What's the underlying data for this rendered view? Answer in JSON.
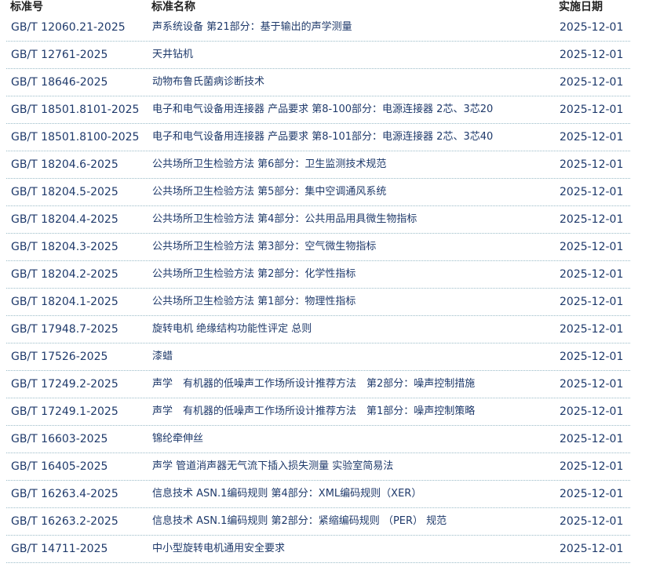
{
  "table": {
    "headers": [
      "标准号",
      "标准名称",
      "实施日期"
    ],
    "rows": [
      [
        "GB/T 12060.21-2025",
        "声系统设备 第21部分：基于输出的声学测量",
        "2025-12-01"
      ],
      [
        "GB/T 12761-2025",
        "天井钻机",
        "2025-12-01"
      ],
      [
        "GB/T 18646-2025",
        "动物布鲁氏菌病诊断技术",
        "2025-12-01"
      ],
      [
        "GB/T 18501.8101-2025",
        "电子和电气设备用连接器 产品要求 第8-100部分：电源连接器 2芯、3芯20",
        "2025-12-01"
      ],
      [
        "GB/T 18501.8100-2025",
        "电子和电气设备用连接器 产品要求 第8-101部分：电源连接器 2芯、3芯40",
        "2025-12-01"
      ],
      [
        "GB/T 18204.6-2025",
        "公共场所卫生检验方法 第6部分：卫生监测技术规范",
        "2025-12-01"
      ],
      [
        "GB/T 18204.5-2025",
        "公共场所卫生检验方法 第5部分：集中空调通风系统",
        "2025-12-01"
      ],
      [
        "GB/T 18204.4-2025",
        "公共场所卫生检验方法 第4部分：公共用品用具微生物指标",
        "2025-12-01"
      ],
      [
        "GB/T 18204.3-2025",
        "公共场所卫生检验方法 第3部分：空气微生物指标",
        "2025-12-01"
      ],
      [
        "GB/T 18204.2-2025",
        "公共场所卫生检验方法 第2部分：化学性指标",
        "2025-12-01"
      ],
      [
        "GB/T 18204.1-2025",
        "公共场所卫生检验方法 第1部分：物理性指标",
        "2025-12-01"
      ],
      [
        "GB/T 17948.7-2025",
        "旋转电机 绝缘结构功能性评定 总则",
        "2025-12-01"
      ],
      [
        "GB/T 17526-2025",
        "漆蜡",
        "2025-12-01"
      ],
      [
        "GB/T 17249.2-2025",
        "声学　有机器的低噪声工作场所设计推荐方法　第2部分：噪声控制措施",
        "2025-12-01"
      ],
      [
        "GB/T 17249.1-2025",
        "声学　有机器的低噪声工作场所设计推荐方法　第1部分：噪声控制策略",
        "2025-12-01"
      ],
      [
        "GB/T 16603-2025",
        "锦纶牵伸丝",
        "2025-12-01"
      ],
      [
        "GB/T 16405-2025",
        "声学 管道消声器无气流下插入损失测量 实验室简易法",
        "2025-12-01"
      ],
      [
        "GB/T 16263.4-2025",
        "信息技术 ASN.1编码规则 第4部分：XML编码规则（XER）",
        "2025-12-01"
      ],
      [
        "GB/T 16263.2-2025",
        "信息技术 ASN.1编码规则 第2部分：紧缩编码规则 （PER） 规范",
        "2025-12-01"
      ],
      [
        "GB/T 14711-2025",
        "中小型旋转电机通用安全要求",
        "2025-12-01"
      ]
    ]
  },
  "colors": {
    "link": "#1f3a6b",
    "header": "#222222",
    "divider": "#9bbcc8"
  }
}
